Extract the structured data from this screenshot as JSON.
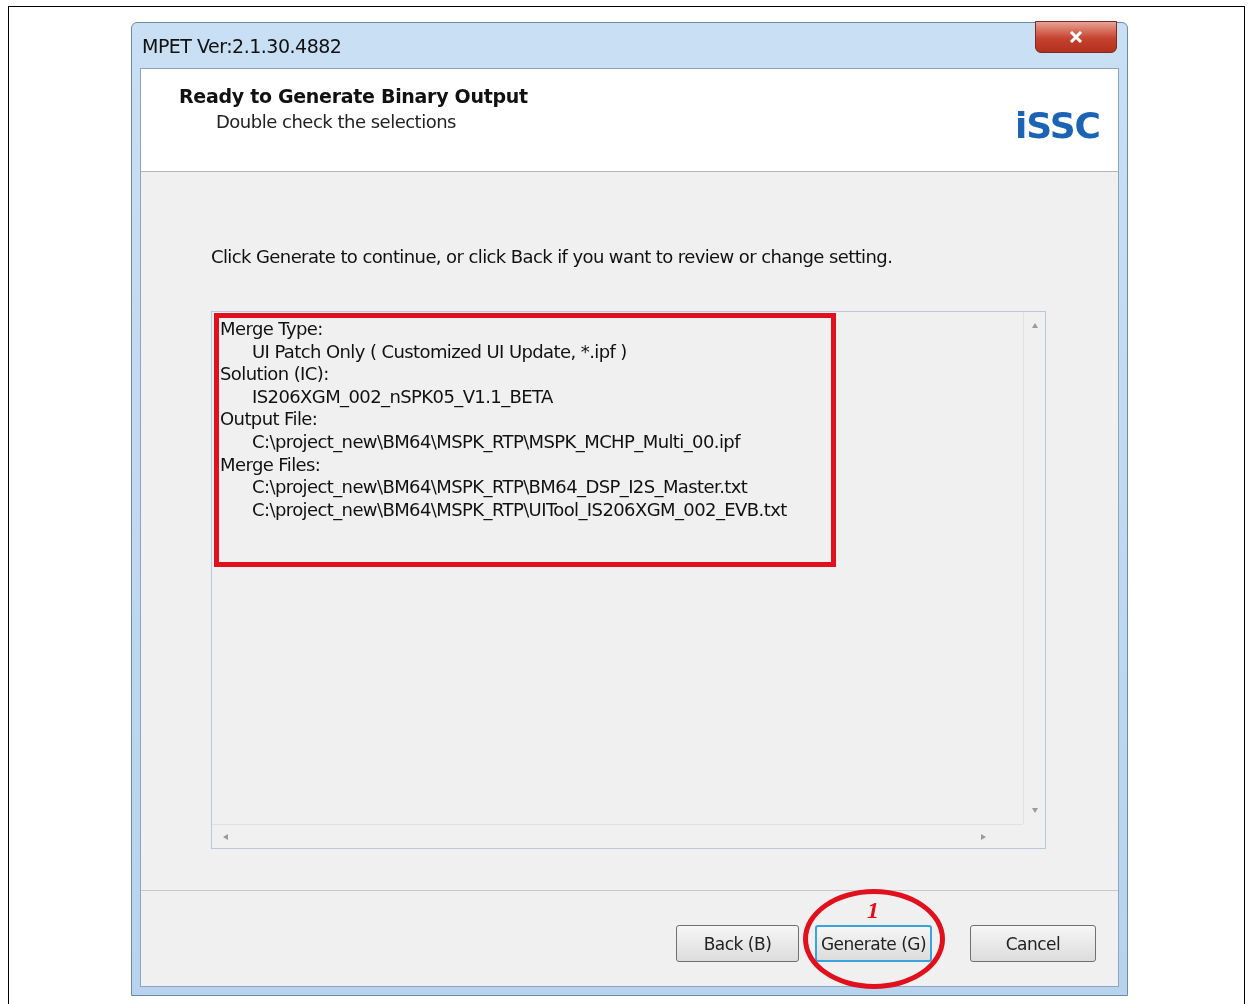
{
  "window": {
    "title": "MPET Ver:2.1.30.4882"
  },
  "header": {
    "title": "Ready to Generate Binary Output",
    "subtitle": "Double check the selections",
    "logo": "iSSC"
  },
  "instruction": "Click Generate to continue, or click Back if you want to review or change setting.",
  "summary": [
    {
      "kind": "label",
      "text": "Merge Type:"
    },
    {
      "kind": "value",
      "text": "UI Patch Only ( Customized UI Update, *.ipf )"
    },
    {
      "kind": "label",
      "text": "Solution (IC):"
    },
    {
      "kind": "value",
      "text": "IS206XGM_002_nSPK05_V1.1_BETA"
    },
    {
      "kind": "label",
      "text": "Output File:"
    },
    {
      "kind": "value",
      "text": "C:\\project_new\\BM64\\MSPK_RTP\\MSPK_MCHP_Multi_00.ipf"
    },
    {
      "kind": "label",
      "text": "Merge Files:"
    },
    {
      "kind": "value",
      "text": "C:\\project_new\\BM64\\MSPK_RTP\\BM64_DSP_I2S_Master.txt"
    },
    {
      "kind": "value",
      "text": "C:\\project_new\\BM64\\MSPK_RTP\\UITool_IS206XGM_002_EVB.txt"
    }
  ],
  "buttons": [
    {
      "label": "Back (B)",
      "focused": false
    },
    {
      "label": "Generate (G)",
      "focused": true,
      "annotation": "1"
    },
    {
      "label": "Cancel",
      "focused": false
    }
  ]
}
